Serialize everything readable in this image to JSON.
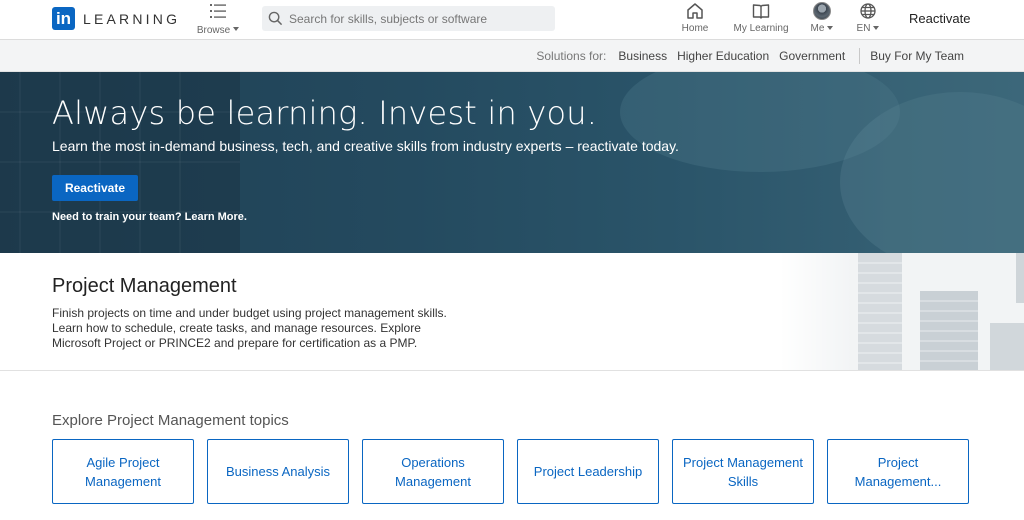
{
  "header": {
    "logo_letters": "in",
    "logo_text": "LEARNING",
    "browse_label": "Browse",
    "search_placeholder": "Search for skills, subjects or software",
    "nav": {
      "home": "Home",
      "my_learning": "My Learning",
      "me": "Me",
      "language": "EN"
    },
    "reactivate_label": "Reactivate"
  },
  "solutions": {
    "label": "Solutions for:",
    "links": [
      "Business",
      "Higher Education",
      "Government"
    ],
    "buy": "Buy For My Team"
  },
  "hero": {
    "title": "Always be learning. Invest in you.",
    "subtitle": "Learn the most in-demand business, tech, and creative skills from industry experts – reactivate today.",
    "cta": "Reactivate",
    "team_text": "Need to train your team? Learn More."
  },
  "topic": {
    "title": "Project Management",
    "description": "Finish projects on time and under budget using project management skills. Learn how to schedule, create tasks, and manage resources. Explore Microsoft Project or PRINCE2 and prepare for certification as a PMP."
  },
  "explore": {
    "title": "Explore Project Management topics",
    "cards": [
      "Agile Project Management",
      "Business Analysis",
      "Operations Management",
      "Project Leadership",
      "Project Management Skills",
      "Project Management..."
    ]
  },
  "colors": {
    "brand": "#0a66c2",
    "hero": "#244a5f"
  }
}
